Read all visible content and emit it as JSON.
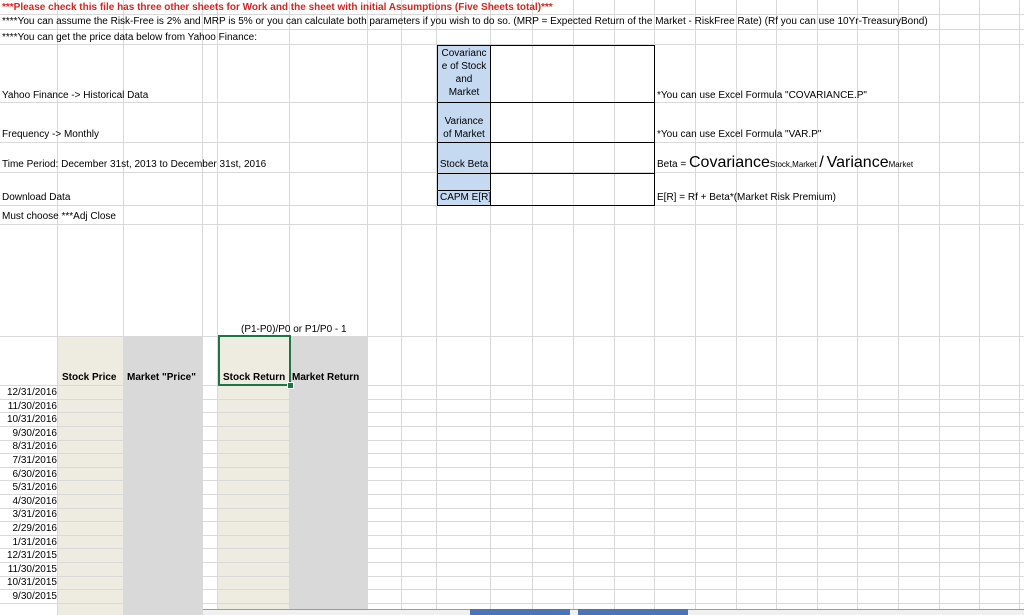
{
  "notes": {
    "line1": "***Please check this file has three other sheets for Work and the sheet with initial Assumptions (Five Sheets total)***",
    "line2": "****You can assume the Risk-Free is 2% and MRP is 5% or you can calculate both parameters if you wish to do so. (MRP = Expected Return of the Market - RiskFree Rate) (Rf you can use 10Yr-TreasuryBond)",
    "line3": "****You can get the price data below from Yahoo Finance:"
  },
  "instructions": {
    "source": "Yahoo Finance -> Historical Data",
    "frequency": "Frequency -> Monthly",
    "period": "Time Period: December 31st, 2013 to December 31st, 2016",
    "download": "Download Data",
    "must_choose": "Must choose ***Adj Close"
  },
  "stats_box": {
    "covariance_label": [
      "Covarianc",
      "e of Stock",
      "and",
      "Market"
    ],
    "variance_label": [
      "Variance",
      "of Market"
    ],
    "beta_label": "Stock Beta",
    "capm_label": "CAPM E[R]"
  },
  "hints": {
    "covariance": "*You can use Excel Formula \"COVARIANCE.P\"",
    "variance": "*You can use Excel Formula \"VAR.P\"",
    "beta_prefix": "Beta =",
    "beta_cov": "Covariance",
    "beta_cov_sub": "Stock,Market",
    "beta_slash": "/",
    "beta_var": "Variance",
    "beta_var_sub": "Market",
    "capm": "E[R] = Rf + Beta*(Market Risk Premium)"
  },
  "return_formula": "(P1-P0)/P0 or P1/P0 - 1",
  "table": {
    "headers": [
      "Stock Price",
      "Market \"Price\"",
      "Stock Return",
      "Market Return"
    ],
    "dates": [
      "12/31/2016",
      "11/30/2016",
      "10/31/2016",
      "9/30/2016",
      "8/31/2016",
      "7/31/2016",
      "6/30/2016",
      "5/31/2016",
      "4/30/2016",
      "3/31/2016",
      "2/29/2016",
      "1/31/2016",
      "12/31/2015",
      "11/30/2015",
      "10/31/2015",
      "9/30/2015"
    ]
  },
  "colors": {
    "red_text": "#d9261c",
    "stats_label_fill": "#c5d9f1",
    "stock_price_fill": "#eeece1",
    "market_price_fill": "#d9d9d9",
    "selected_border": "#217346"
  }
}
